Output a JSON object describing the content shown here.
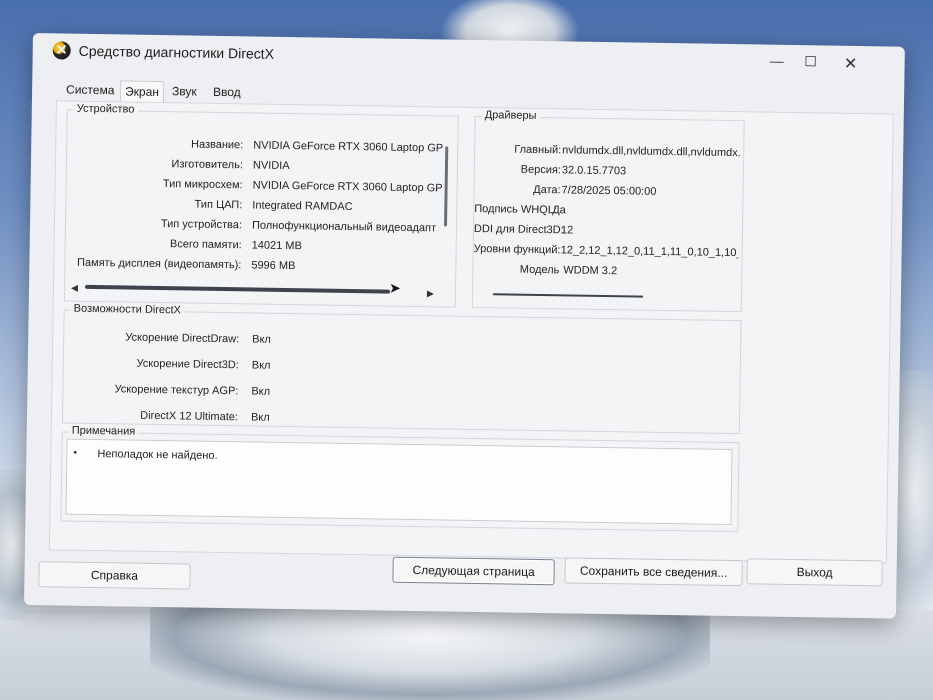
{
  "window": {
    "title": "Средство диагностики DirectX",
    "minimize": "—",
    "maximize": "☐",
    "close": "✕"
  },
  "tabs": [
    {
      "label": "Система",
      "active": false
    },
    {
      "label": "Экран",
      "active": true
    },
    {
      "label": "Звук",
      "active": false
    },
    {
      "label": "Ввод",
      "active": false
    }
  ],
  "device": {
    "title": "Устройство",
    "rows": [
      {
        "label": "Название:",
        "value": "NVIDIA GeForce RTX 3060 Laptop GP"
      },
      {
        "label": "Изготовитель:",
        "value": "NVIDIA"
      },
      {
        "label": "Тип микросхем:",
        "value": "NVIDIA GeForce RTX 3060 Laptop GP"
      },
      {
        "label": "Тип ЦАП:",
        "value": "Integrated RAMDAC"
      },
      {
        "label": "Тип устройства:",
        "value": "Полнофункциональный видеоадапт"
      },
      {
        "label": "Всего памяти:",
        "value": "14021 MB"
      },
      {
        "label": "Память дисплея (видеопамять):",
        "value": "5996 MB"
      }
    ]
  },
  "drivers": {
    "title": "Драйверы",
    "rows": [
      {
        "label": "Главный:",
        "value": "nvldumdx.dll,nvldumdx.dll,nvldumdx.d"
      },
      {
        "label": "Версия:",
        "value": "32.0.15.7703"
      },
      {
        "label": "Дата:",
        "value": "7/28/2025 05:00:00"
      },
      {
        "label": "Подпись WHQL:",
        "value": "Да"
      },
      {
        "label": "DDI для Direct3D:",
        "value": "12"
      },
      {
        "label": "Уровни функций:",
        "value": "12_2,12_1,12_0,11_1,11_0,10_1,10_"
      },
      {
        "label": "Модель",
        "value": "WDDM 3.2"
      }
    ]
  },
  "directx": {
    "title": "Возможности DirectX",
    "rows": [
      {
        "label": "Ускорение DirectDraw:",
        "value": "Вкл"
      },
      {
        "label": "Ускорение Direct3D:",
        "value": "Вкл"
      },
      {
        "label": "Ускорение текстур AGP:",
        "value": "Вкл"
      },
      {
        "label": "DirectX 12 Ultimate:",
        "value": "Вкл"
      }
    ]
  },
  "notes": {
    "title": "Примечания",
    "bullet": "•",
    "text": "Неполадок не найдено."
  },
  "buttons": {
    "help": "Справка",
    "next": "Следующая страница",
    "save": "Сохранить все сведения...",
    "exit": "Выход"
  },
  "scroll_arrows": {
    "left": "◀",
    "right": "▶"
  }
}
